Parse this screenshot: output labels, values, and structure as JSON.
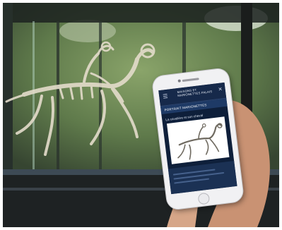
{
  "phone_screen": {
    "brand": "MAISONS ET MARIONETTES PALAIS",
    "tab_label": "PORTRAIT MARIONETTES",
    "title": "La cavalière et son cheval"
  }
}
